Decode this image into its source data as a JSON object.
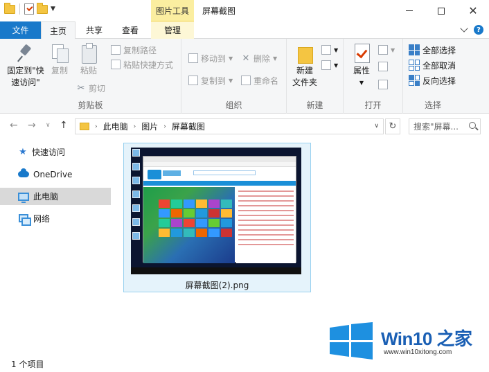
{
  "titlebar": {
    "contextual_tab": "图片工具",
    "title": "屏幕截图",
    "minimize": "",
    "maximize": "",
    "close": "✕"
  },
  "tabs": {
    "file": "文件",
    "home": "主页",
    "share": "共享",
    "view": "查看",
    "manage": "管理"
  },
  "ribbon": {
    "clipboard": {
      "label": "剪贴板",
      "pin_line1": "固定到\"快",
      "pin_line2": "速访问\"",
      "copy": "复制",
      "paste": "粘贴",
      "copy_path": "复制路径",
      "paste_shortcut": "粘贴快捷方式",
      "cut": "剪切"
    },
    "organize": {
      "label": "组织",
      "move_to": "移动到",
      "copy_to": "复制到",
      "delete": "删除",
      "rename": "重命名"
    },
    "new": {
      "label": "新建",
      "new_folder_line1": "新建",
      "new_folder_line2": "文件夹"
    },
    "open": {
      "label": "打开",
      "properties": "属性"
    },
    "select": {
      "label": "选择",
      "select_all": "全部选择",
      "select_none": "全部取消",
      "invert": "反向选择"
    }
  },
  "address": {
    "crumbs": [
      "此电脑",
      "图片",
      "屏幕截图"
    ],
    "search_placeholder": "搜索\"屏幕..."
  },
  "navpane": {
    "items": [
      {
        "label": "快速访问"
      },
      {
        "label": "OneDrive"
      },
      {
        "label": "此电脑"
      },
      {
        "label": "网络"
      }
    ]
  },
  "content": {
    "file_name": "屏幕截图(2).png"
  },
  "status": {
    "count": "1 个项目"
  },
  "watermark": {
    "brand": "Win10 之家",
    "url": "www.win10xitong.com"
  },
  "colors": {
    "accent": "#1979ca",
    "contextual": "#fbeea0",
    "selection": "#e5f3fb"
  }
}
